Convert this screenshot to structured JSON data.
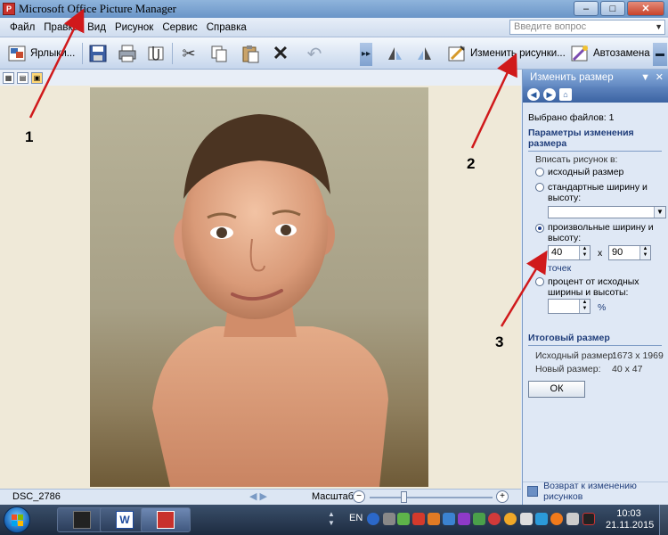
{
  "window": {
    "title": "Microsoft Office Picture Manager",
    "min_glyph": "–",
    "max_glyph": "□",
    "close_glyph": "✕"
  },
  "menu": {
    "items": [
      "Файл",
      "Правка",
      "Вид",
      "Рисунок",
      "Сервис",
      "Справка"
    ],
    "help_placeholder": "Введите вопрос"
  },
  "toolbar": {
    "shortcuts_label": "Ярлыки...",
    "edit_pictures_label": "Изменить рисунки...",
    "autocorrect_label": "Автозамена"
  },
  "photo": {
    "filename": "DSC_2786"
  },
  "statusbar": {
    "zoom_label": "Масштаб:"
  },
  "pane": {
    "title": "Изменить размер",
    "files_selected": "Выбрано файлов: 1",
    "section_title": "Параметры изменения размера",
    "fit_label": "Вписать рисунок в:",
    "opt_original": "исходный размер",
    "opt_standard": "стандартные ширину и высоту:",
    "opt_custom": "произвольные ширину и высоту:",
    "width_value": "40",
    "x_sep": "x",
    "height_value": "90",
    "unit_points": "точек",
    "opt_percent": "процент от исходных ширины и высоты:",
    "percent_unit": "%",
    "result_title": "Итоговый размер",
    "original_size_label": "Исходный размер:",
    "original_size_value": "1673 x 1969",
    "new_size_label": "Новый размер:",
    "new_size_value": "40 x 47",
    "ok_label": "ОК",
    "back_link": "Возврат к изменению рисунков"
  },
  "taskbar": {
    "lang": "EN",
    "time": "10:03",
    "date": "21.11.2015"
  },
  "annotations": [
    "1",
    "2",
    "3"
  ],
  "colors": {
    "arrow": "#d0191b",
    "accent": "#1f3d7a"
  }
}
